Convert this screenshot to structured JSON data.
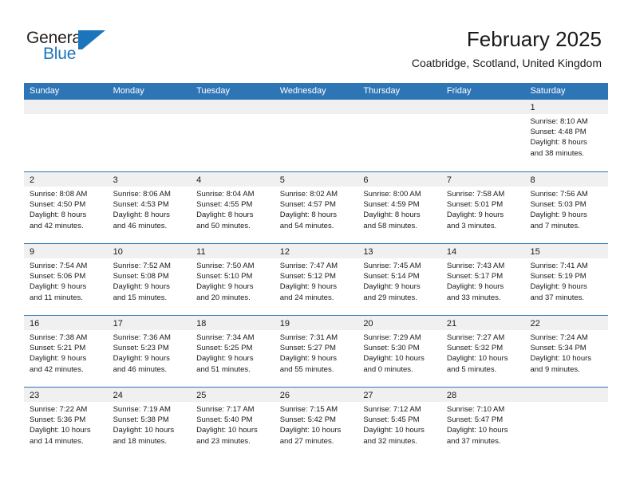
{
  "brand": {
    "name_part1": "General",
    "name_part2": "Blue",
    "logo_icon": "triangle-flag-icon",
    "accent_color": "#1b75bb"
  },
  "header": {
    "month_title": "February 2025",
    "location": "Coatbridge, Scotland, United Kingdom"
  },
  "theme": {
    "header_band": "#2e75b6",
    "daynum_band": "#f0f0f0",
    "grid_line": "#2e75b6",
    "text": "#1a1a1a"
  },
  "calendar": {
    "weekday_headers": [
      "Sunday",
      "Monday",
      "Tuesday",
      "Wednesday",
      "Thursday",
      "Friday",
      "Saturday"
    ],
    "weeks": [
      [
        {
          "day": "",
          "sunrise": "",
          "sunset": "",
          "daylight_line1": "",
          "daylight_line2": ""
        },
        {
          "day": "",
          "sunrise": "",
          "sunset": "",
          "daylight_line1": "",
          "daylight_line2": ""
        },
        {
          "day": "",
          "sunrise": "",
          "sunset": "",
          "daylight_line1": "",
          "daylight_line2": ""
        },
        {
          "day": "",
          "sunrise": "",
          "sunset": "",
          "daylight_line1": "",
          "daylight_line2": ""
        },
        {
          "day": "",
          "sunrise": "",
          "sunset": "",
          "daylight_line1": "",
          "daylight_line2": ""
        },
        {
          "day": "",
          "sunrise": "",
          "sunset": "",
          "daylight_line1": "",
          "daylight_line2": ""
        },
        {
          "day": "1",
          "sunrise": "Sunrise: 8:10 AM",
          "sunset": "Sunset: 4:48 PM",
          "daylight_line1": "Daylight: 8 hours",
          "daylight_line2": "and 38 minutes."
        }
      ],
      [
        {
          "day": "2",
          "sunrise": "Sunrise: 8:08 AM",
          "sunset": "Sunset: 4:50 PM",
          "daylight_line1": "Daylight: 8 hours",
          "daylight_line2": "and 42 minutes."
        },
        {
          "day": "3",
          "sunrise": "Sunrise: 8:06 AM",
          "sunset": "Sunset: 4:53 PM",
          "daylight_line1": "Daylight: 8 hours",
          "daylight_line2": "and 46 minutes."
        },
        {
          "day": "4",
          "sunrise": "Sunrise: 8:04 AM",
          "sunset": "Sunset: 4:55 PM",
          "daylight_line1": "Daylight: 8 hours",
          "daylight_line2": "and 50 minutes."
        },
        {
          "day": "5",
          "sunrise": "Sunrise: 8:02 AM",
          "sunset": "Sunset: 4:57 PM",
          "daylight_line1": "Daylight: 8 hours",
          "daylight_line2": "and 54 minutes."
        },
        {
          "day": "6",
          "sunrise": "Sunrise: 8:00 AM",
          "sunset": "Sunset: 4:59 PM",
          "daylight_line1": "Daylight: 8 hours",
          "daylight_line2": "and 58 minutes."
        },
        {
          "day": "7",
          "sunrise": "Sunrise: 7:58 AM",
          "sunset": "Sunset: 5:01 PM",
          "daylight_line1": "Daylight: 9 hours",
          "daylight_line2": "and 3 minutes."
        },
        {
          "day": "8",
          "sunrise": "Sunrise: 7:56 AM",
          "sunset": "Sunset: 5:03 PM",
          "daylight_line1": "Daylight: 9 hours",
          "daylight_line2": "and 7 minutes."
        }
      ],
      [
        {
          "day": "9",
          "sunrise": "Sunrise: 7:54 AM",
          "sunset": "Sunset: 5:06 PM",
          "daylight_line1": "Daylight: 9 hours",
          "daylight_line2": "and 11 minutes."
        },
        {
          "day": "10",
          "sunrise": "Sunrise: 7:52 AM",
          "sunset": "Sunset: 5:08 PM",
          "daylight_line1": "Daylight: 9 hours",
          "daylight_line2": "and 15 minutes."
        },
        {
          "day": "11",
          "sunrise": "Sunrise: 7:50 AM",
          "sunset": "Sunset: 5:10 PM",
          "daylight_line1": "Daylight: 9 hours",
          "daylight_line2": "and 20 minutes."
        },
        {
          "day": "12",
          "sunrise": "Sunrise: 7:47 AM",
          "sunset": "Sunset: 5:12 PM",
          "daylight_line1": "Daylight: 9 hours",
          "daylight_line2": "and 24 minutes."
        },
        {
          "day": "13",
          "sunrise": "Sunrise: 7:45 AM",
          "sunset": "Sunset: 5:14 PM",
          "daylight_line1": "Daylight: 9 hours",
          "daylight_line2": "and 29 minutes."
        },
        {
          "day": "14",
          "sunrise": "Sunrise: 7:43 AM",
          "sunset": "Sunset: 5:17 PM",
          "daylight_line1": "Daylight: 9 hours",
          "daylight_line2": "and 33 minutes."
        },
        {
          "day": "15",
          "sunrise": "Sunrise: 7:41 AM",
          "sunset": "Sunset: 5:19 PM",
          "daylight_line1": "Daylight: 9 hours",
          "daylight_line2": "and 37 minutes."
        }
      ],
      [
        {
          "day": "16",
          "sunrise": "Sunrise: 7:38 AM",
          "sunset": "Sunset: 5:21 PM",
          "daylight_line1": "Daylight: 9 hours",
          "daylight_line2": "and 42 minutes."
        },
        {
          "day": "17",
          "sunrise": "Sunrise: 7:36 AM",
          "sunset": "Sunset: 5:23 PM",
          "daylight_line1": "Daylight: 9 hours",
          "daylight_line2": "and 46 minutes."
        },
        {
          "day": "18",
          "sunrise": "Sunrise: 7:34 AM",
          "sunset": "Sunset: 5:25 PM",
          "daylight_line1": "Daylight: 9 hours",
          "daylight_line2": "and 51 minutes."
        },
        {
          "day": "19",
          "sunrise": "Sunrise: 7:31 AM",
          "sunset": "Sunset: 5:27 PM",
          "daylight_line1": "Daylight: 9 hours",
          "daylight_line2": "and 55 minutes."
        },
        {
          "day": "20",
          "sunrise": "Sunrise: 7:29 AM",
          "sunset": "Sunset: 5:30 PM",
          "daylight_line1": "Daylight: 10 hours",
          "daylight_line2": "and 0 minutes."
        },
        {
          "day": "21",
          "sunrise": "Sunrise: 7:27 AM",
          "sunset": "Sunset: 5:32 PM",
          "daylight_line1": "Daylight: 10 hours",
          "daylight_line2": "and 5 minutes."
        },
        {
          "day": "22",
          "sunrise": "Sunrise: 7:24 AM",
          "sunset": "Sunset: 5:34 PM",
          "daylight_line1": "Daylight: 10 hours",
          "daylight_line2": "and 9 minutes."
        }
      ],
      [
        {
          "day": "23",
          "sunrise": "Sunrise: 7:22 AM",
          "sunset": "Sunset: 5:36 PM",
          "daylight_line1": "Daylight: 10 hours",
          "daylight_line2": "and 14 minutes."
        },
        {
          "day": "24",
          "sunrise": "Sunrise: 7:19 AM",
          "sunset": "Sunset: 5:38 PM",
          "daylight_line1": "Daylight: 10 hours",
          "daylight_line2": "and 18 minutes."
        },
        {
          "day": "25",
          "sunrise": "Sunrise: 7:17 AM",
          "sunset": "Sunset: 5:40 PM",
          "daylight_line1": "Daylight: 10 hours",
          "daylight_line2": "and 23 minutes."
        },
        {
          "day": "26",
          "sunrise": "Sunrise: 7:15 AM",
          "sunset": "Sunset: 5:42 PM",
          "daylight_line1": "Daylight: 10 hours",
          "daylight_line2": "and 27 minutes."
        },
        {
          "day": "27",
          "sunrise": "Sunrise: 7:12 AM",
          "sunset": "Sunset: 5:45 PM",
          "daylight_line1": "Daylight: 10 hours",
          "daylight_line2": "and 32 minutes."
        },
        {
          "day": "28",
          "sunrise": "Sunrise: 7:10 AM",
          "sunset": "Sunset: 5:47 PM",
          "daylight_line1": "Daylight: 10 hours",
          "daylight_line2": "and 37 minutes."
        },
        {
          "day": "",
          "sunrise": "",
          "sunset": "",
          "daylight_line1": "",
          "daylight_line2": ""
        }
      ]
    ]
  }
}
